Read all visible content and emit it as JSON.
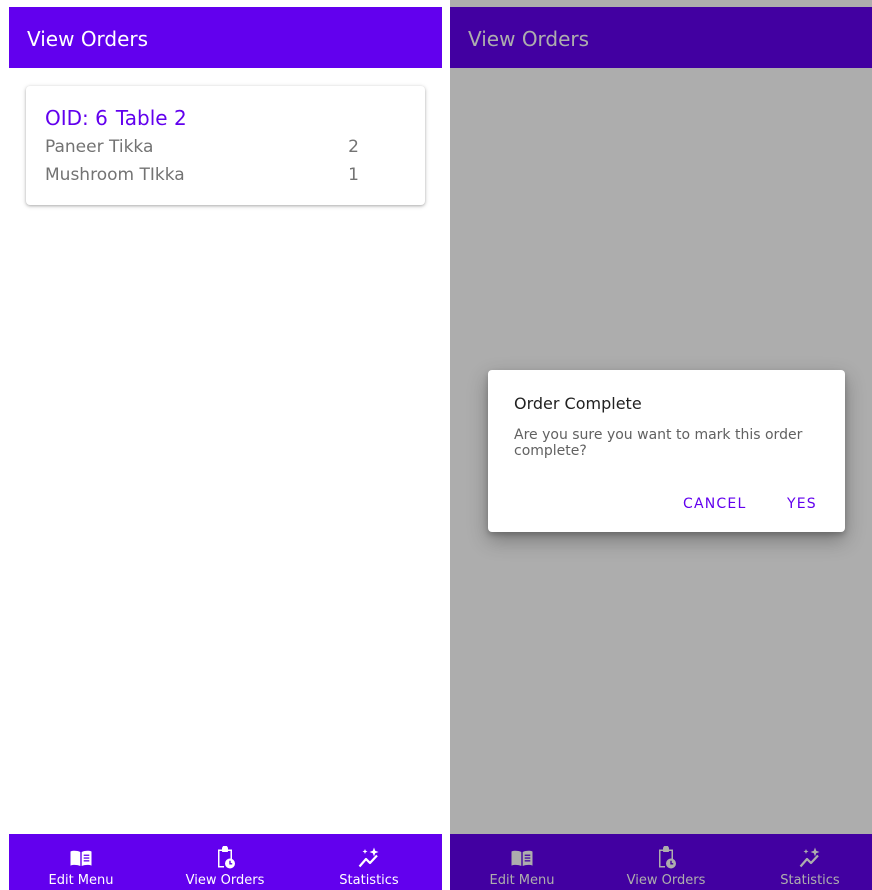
{
  "left_screen": {
    "appbar": {
      "title": "View Orders"
    },
    "order": {
      "oid": "OID: 6",
      "table": "Table 2",
      "items": [
        {
          "name": "Paneer Tikka",
          "qty": "2"
        },
        {
          "name": "Mushroom TIkka",
          "qty": "1"
        }
      ]
    },
    "bottom_nav": [
      {
        "label": "Edit Menu",
        "icon": "menu-book-icon"
      },
      {
        "label": "View Orders",
        "icon": "clipboard-clock-icon"
      },
      {
        "label": "Statistics",
        "icon": "sparkle-trend-icon"
      }
    ]
  },
  "right_screen": {
    "appbar": {
      "title": "View Orders"
    },
    "dialog": {
      "title": "Order Complete",
      "message": "Are you sure you want to mark this order complete?",
      "cancel_label": "CANCEL",
      "confirm_label": "YES"
    },
    "bottom_nav": [
      {
        "label": "Edit Menu",
        "icon": "menu-book-icon"
      },
      {
        "label": "View Orders",
        "icon": "clipboard-clock-icon"
      },
      {
        "label": "Statistics",
        "icon": "sparkle-trend-icon"
      }
    ]
  },
  "colors": {
    "primary": "#6200ee",
    "scrim": "#000000",
    "secondary_text": "#737373"
  }
}
